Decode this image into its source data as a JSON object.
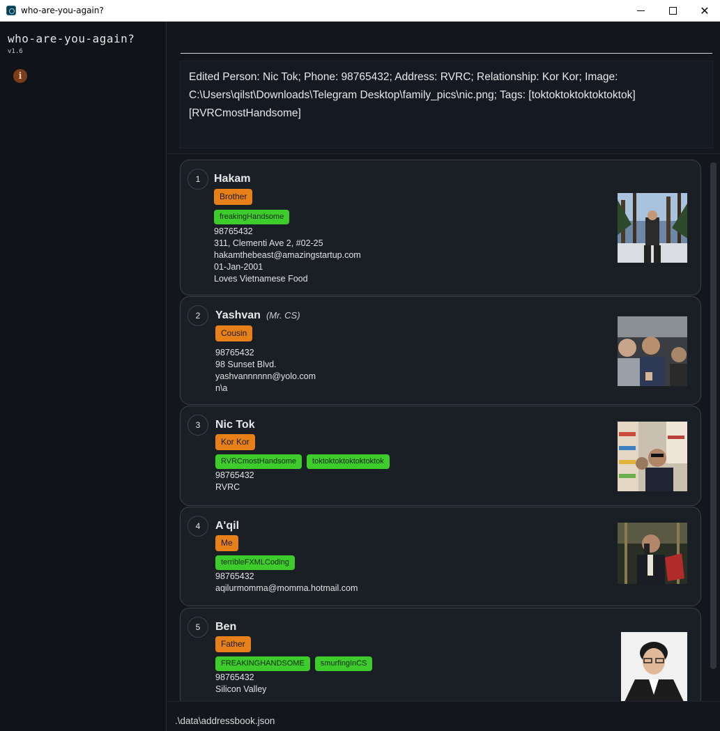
{
  "window": {
    "title": "who-are-you-again?",
    "minimize_glyph": "",
    "close_glyph": "✕"
  },
  "sidebar": {
    "app_name": "who-are-you-again?",
    "version": "v1.6",
    "info_icon": "i"
  },
  "command": {
    "value": ""
  },
  "result": {
    "text": "Edited Person: Nic Tok; Phone: 98765432; Address: RVRC; Relationship: Kor Kor; Image: C:\\Users\\qilst\\Downloads\\Telegram Desktop\\family_pics\\nic.png; Tags: [toktoktoktoktoktoktok][RVRCmostHandsome]"
  },
  "persons": [
    {
      "index": "1",
      "name": "Hakam",
      "nickname": "",
      "relationship": "Brother",
      "tags": [
        "freakingHandsome"
      ],
      "fields": [
        "98765432",
        "311, Clementi Ave 2, #02-25",
        "hakamthebeast@amazingstartup.com",
        "01-Jan-2001",
        "Loves Vietnamese Food"
      ]
    },
    {
      "index": "2",
      "name": "Yashvan",
      "nickname": "(Mr. CS)",
      "relationship": "Cousin",
      "tags": [],
      "fields": [
        "98765432",
        "98 Sunset Blvd.",
        "yashvannnnnn@yolo.com",
        "n\\a"
      ]
    },
    {
      "index": "3",
      "name": "Nic Tok",
      "nickname": "",
      "relationship": "Kor Kor",
      "tags": [
        "RVRCmostHandsome",
        "toktoktoktoktoktoktok"
      ],
      "fields": [
        "98765432",
        "RVRC"
      ]
    },
    {
      "index": "4",
      "name": "A'qil",
      "nickname": "",
      "relationship": "Me",
      "tags": [
        "terribleFXMLCoding"
      ],
      "fields": [
        "98765432",
        "aqilurmomma@momma.hotmail.com"
      ]
    },
    {
      "index": "5",
      "name": "Ben",
      "nickname": "",
      "relationship": "Father",
      "tags": [
        "FREAKINGHANDSOME",
        "smurfingInCS"
      ],
      "fields": [
        "98765432",
        "Silicon Valley"
      ]
    }
  ],
  "footer": {
    "path": ".\\data\\addressbook.json"
  },
  "colors": {
    "relationship_badge": "#e8801a",
    "tag": "#3ecb2c",
    "background": "#13161c"
  }
}
